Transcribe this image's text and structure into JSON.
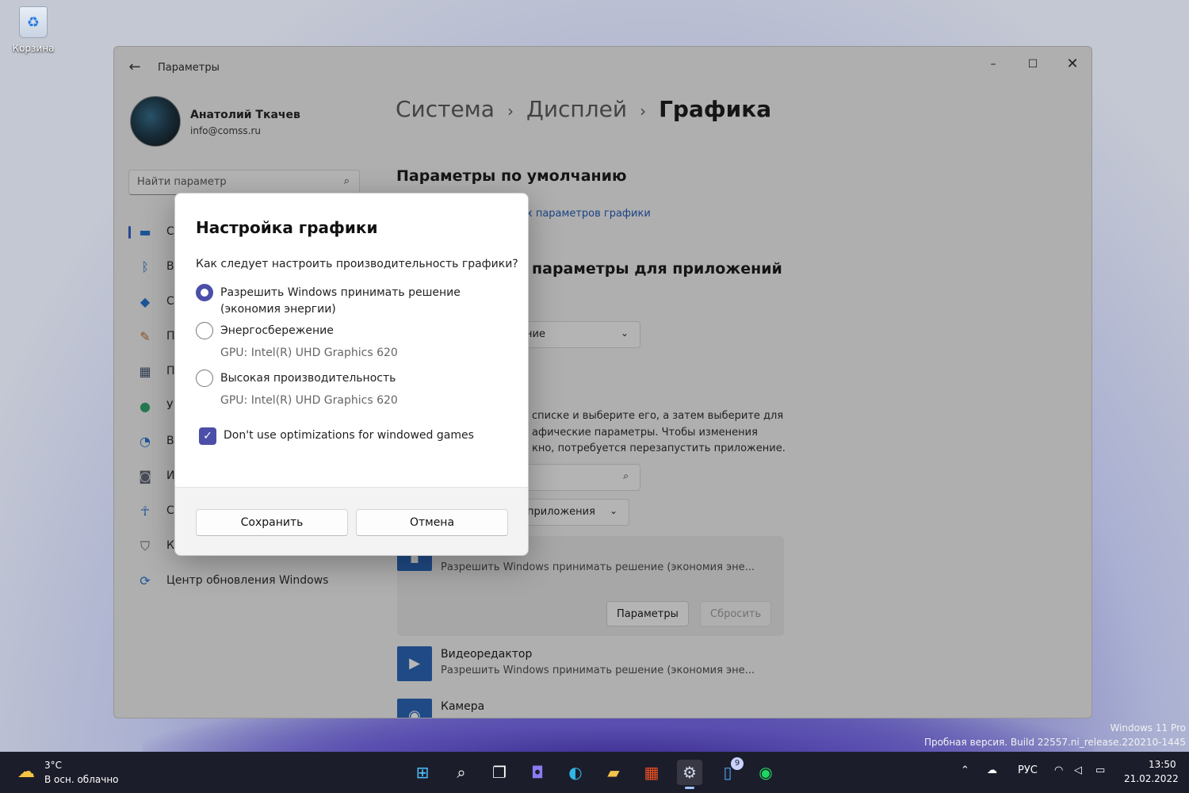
{
  "desktop": {
    "recycle_bin_label": "Корзина",
    "watermark_line1": "Windows 11 Pro",
    "watermark_line2": "Пробная версия. Build 22557.ni_release.220210-1445"
  },
  "window": {
    "app_title": "Параметры",
    "controls": {
      "minimize": "–",
      "maximize": "☐",
      "close": "✕"
    }
  },
  "profile": {
    "name": "Анатолий Ткачев",
    "email": "info@comss.ru"
  },
  "search": {
    "placeholder": "Найти параметр"
  },
  "sidebar": {
    "items": [
      {
        "label": "С",
        "icon": "display-icon",
        "active": true
      },
      {
        "label": "В",
        "icon": "bluetooth-icon"
      },
      {
        "label": "С",
        "icon": "wifi-icon"
      },
      {
        "label": "П",
        "icon": "brush-icon"
      },
      {
        "label": "П",
        "icon": "apps-icon"
      },
      {
        "label": "У",
        "icon": "person-icon"
      },
      {
        "label": "В",
        "icon": "clock-globe-icon"
      },
      {
        "label": "И",
        "icon": "gamepad-icon"
      },
      {
        "label": "С",
        "icon": "accessibility-icon"
      },
      {
        "label": "К",
        "icon": "shield-icon"
      },
      {
        "label": "Центр обновления Windows",
        "icon": "update-icon"
      }
    ]
  },
  "breadcrumb": {
    "parent1": "Система",
    "parent2": "Дисплей",
    "current": "Графика"
  },
  "content": {
    "section_default": "Параметры по умолчанию",
    "default_link": "х параметров графики",
    "section_apps": "параметры для приложений",
    "dropdown_pref": "ение",
    "desc_line1": "списке и выберите его, а затем выберите для",
    "desc_line2": "афические параметры. Чтобы изменения",
    "desc_line3": "кно, потребуется перезапустить приложение.",
    "filter_dropdown": "приложения",
    "card_app_desc": "Разрешить Windows принимать решение (экономия эне...",
    "card_params_btn": "Параметры",
    "card_reset_btn": "Сбросить",
    "apps": [
      {
        "name": "Видеоредактор",
        "desc": "Разрешить Windows принимать решение (экономия эне..."
      },
      {
        "name": "Камера",
        "desc": ""
      }
    ]
  },
  "dialog": {
    "title": "Настройка графики",
    "question": "Как следует настроить производительность графики?",
    "options": [
      {
        "line1": "Разрешить Windows принимать решение",
        "line2": "(экономия энергии)",
        "selected": true
      },
      {
        "line1": "Энергосбережение",
        "gpu": "GPU: Intel(R) UHD Graphics 620",
        "selected": false
      },
      {
        "line1": "Высокая производительность",
        "gpu": "GPU: Intel(R) UHD Graphics 620",
        "selected": false
      }
    ],
    "checkbox_label": "Don't use optimizations for windowed games",
    "checkbox_checked": true,
    "save_label": "Сохранить",
    "cancel_label": "Отмена"
  },
  "taskbar": {
    "weather_temp": "3°C",
    "weather_desc": "В осн. облачно",
    "store_badge": "9",
    "language": "РУС",
    "time": "13:50",
    "date": "21.02.2022",
    "icons": [
      "start-icon",
      "search-icon",
      "task-view-icon",
      "chat-icon",
      "edge-icon",
      "explorer-icon",
      "store-icon",
      "settings-icon",
      "notepad-icon",
      "spotify-icon"
    ]
  },
  "colors": {
    "accent": "#4b4fa8",
    "link": "#1a55b5",
    "taskbar": "#1c1d2b"
  }
}
